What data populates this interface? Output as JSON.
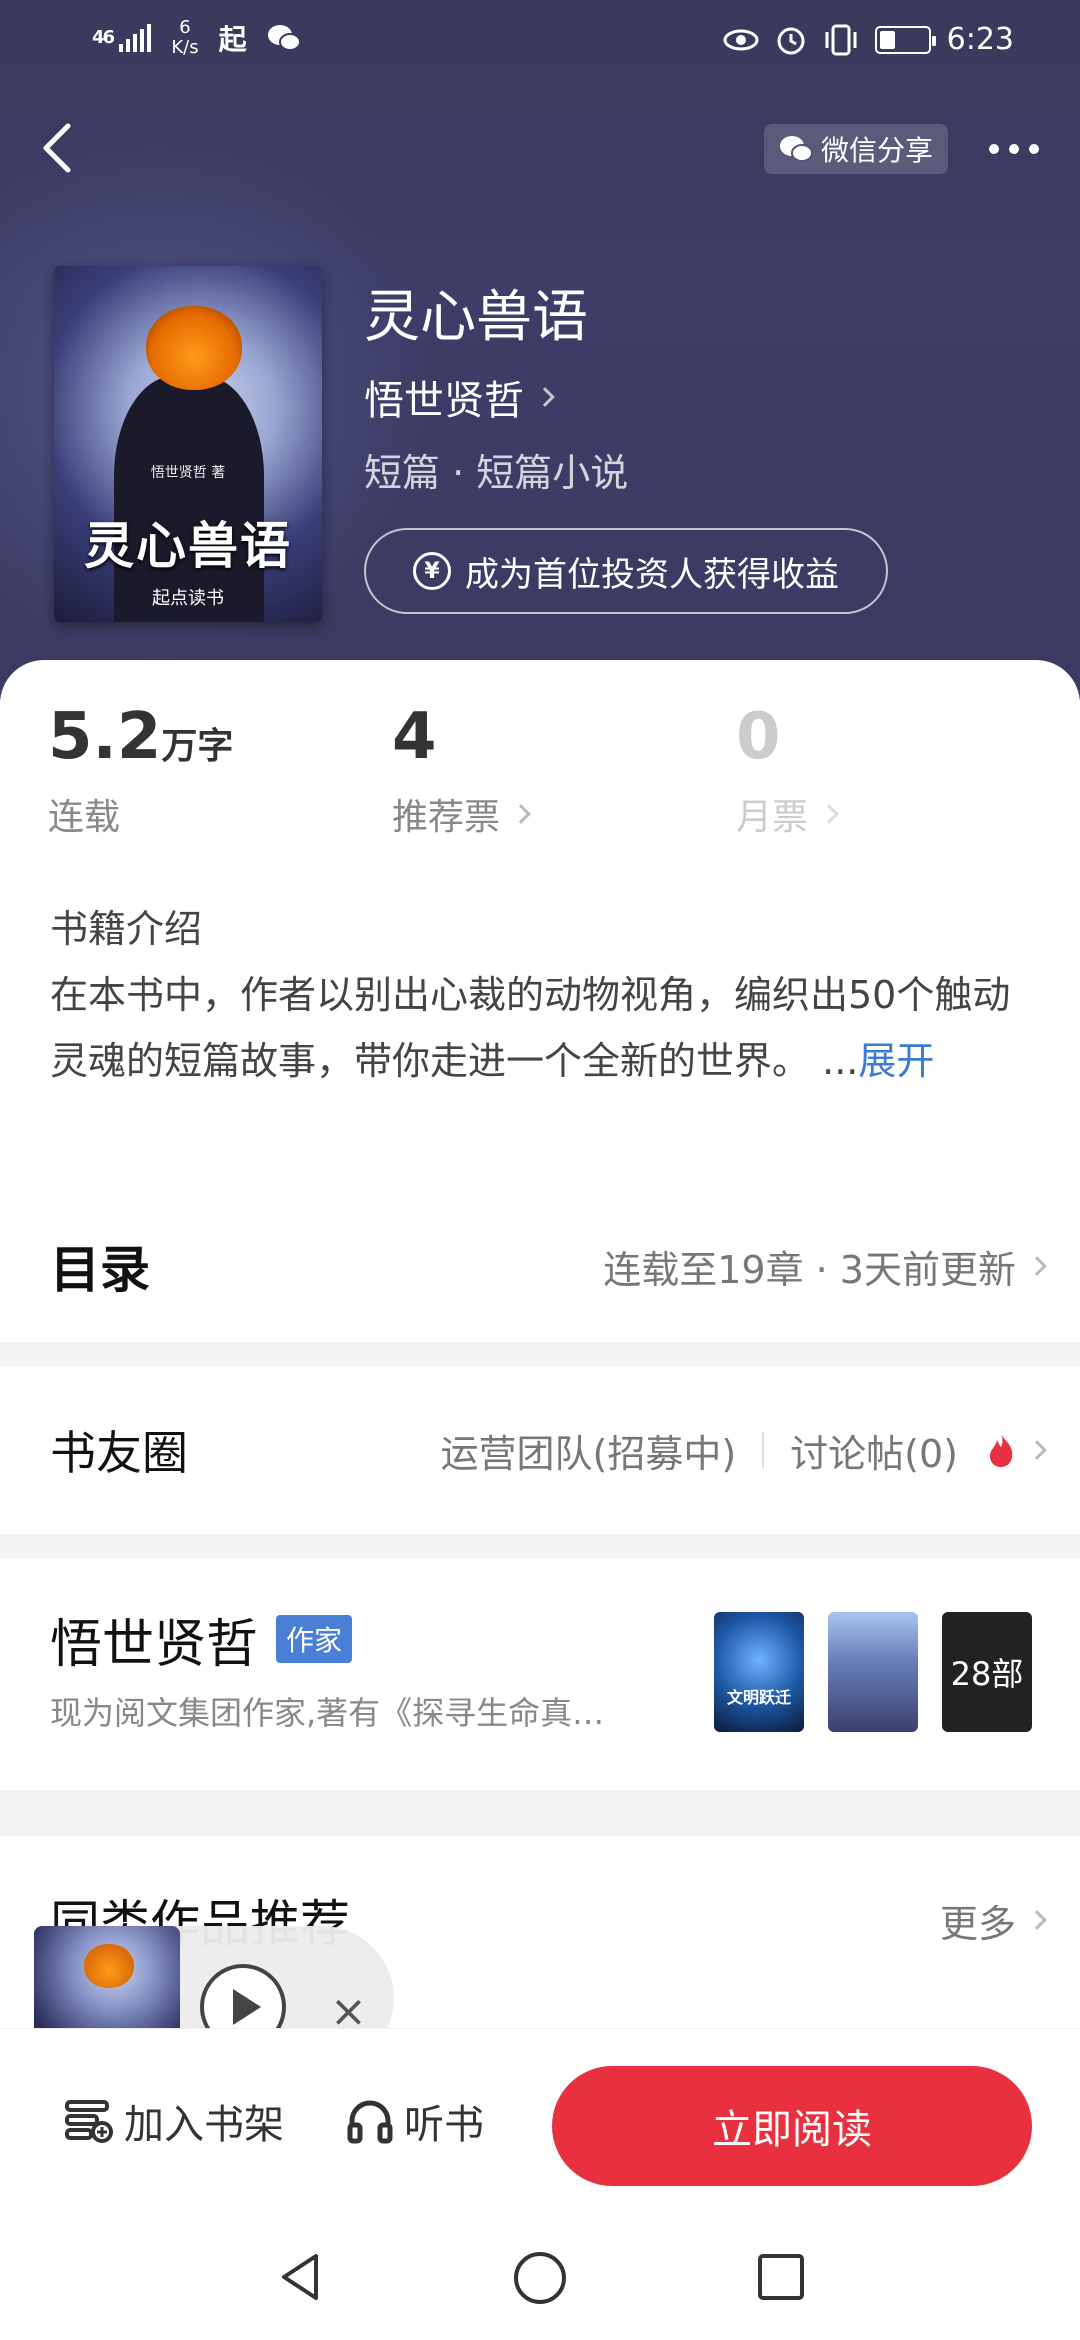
{
  "status_bar": {
    "signal": "46",
    "speed": "6",
    "speed_unit": "K/s",
    "app_label": "起",
    "time": "6:23"
  },
  "header": {
    "share_label": "微信分享"
  },
  "book": {
    "title": "灵心兽语",
    "author": "悟世贤哲",
    "category": "短篇 · 短篇小说",
    "invest_label": "成为首位投资人获得收益",
    "cover_title": "灵心兽语",
    "cover_author": "悟世贤哲 著",
    "cover_publisher": "起点读书"
  },
  "stats": {
    "words_value": "5.2",
    "words_unit": "万字",
    "words_label": "连载",
    "recommend_value": "4",
    "recommend_label": "推荐票",
    "monthly_value": "0",
    "monthly_label": "月票"
  },
  "intro": {
    "heading": "书籍介绍",
    "text": "在本书中，作者以别出心裁的动物视角，编织出50个触动灵魂的短篇故事，带你走进一个全新的世界。",
    "ellipsis": "...",
    "expand_label": "展开"
  },
  "toc": {
    "title": "目录",
    "status": "连载至19章 · 3天前更新"
  },
  "circle": {
    "title": "书友圈",
    "team_label": "运营团队(招募中)",
    "posts_label": "讨论帖(0)"
  },
  "author_section": {
    "name": "悟世贤哲",
    "tag": "作家",
    "description": "现为阅文集团作家,著有《探寻生命真…",
    "thumb1_title": "文明跃迁",
    "works_count": "28部"
  },
  "similar": {
    "title": "同类作品推荐",
    "more_label": "更多"
  },
  "bottom_bar": {
    "shelf_label": "加入书架",
    "listen_label": "听书",
    "read_label": "立即阅读"
  },
  "colors": {
    "accent_red": "#e8303e",
    "link_blue": "#3a7bd5",
    "tag_blue": "#4a7fd6",
    "header_bg": "#3a3a62"
  }
}
